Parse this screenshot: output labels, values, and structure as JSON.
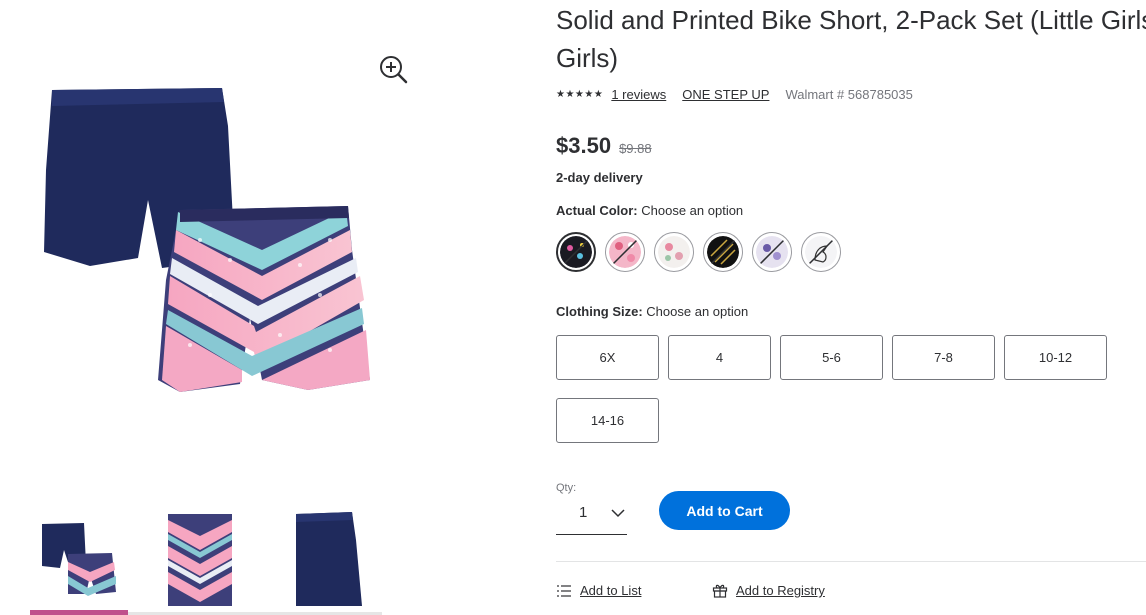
{
  "product": {
    "title_line1": "Solid and Printed Bike Short, 2-Pack Set (Little Girls",
    "title_line2": "Girls)",
    "rating_stars": "★★★★★",
    "reviews_label": "1 reviews",
    "brand": "ONE STEP UP",
    "sku_label": "Walmart # 568785035",
    "price": "$3.50",
    "was_price": "$9.88",
    "delivery": "2-day delivery"
  },
  "color_option": {
    "label": "Actual Color:",
    "value": "Choose an option",
    "swatches": [
      {
        "name": "black-multi",
        "available": false
      },
      {
        "name": "pink-floral",
        "available": false
      },
      {
        "name": "white-floral",
        "available": true
      },
      {
        "name": "black-gold",
        "available": false
      },
      {
        "name": "purple-print",
        "available": false
      },
      {
        "name": "unicorn",
        "available": false
      }
    ]
  },
  "size_option": {
    "label": "Clothing Size:",
    "value": "Choose an option",
    "sizes": [
      "6X",
      "4",
      "5-6",
      "7-8",
      "10-12",
      "14-16"
    ]
  },
  "purchase": {
    "qty_label": "Qty:",
    "qty_value": "1",
    "add_to_cart": "Add to Cart"
  },
  "actions": {
    "add_to_list": "Add to List",
    "add_to_registry": "Add to Registry"
  },
  "colors": {
    "accent": "#0071dc",
    "navy": "#1f2a5c",
    "thumb_active": "#c0508c"
  },
  "icons": {
    "zoom": "zoom-in-icon",
    "chevron": "chevron-down-icon",
    "list": "list-icon",
    "registry": "gift-icon"
  }
}
